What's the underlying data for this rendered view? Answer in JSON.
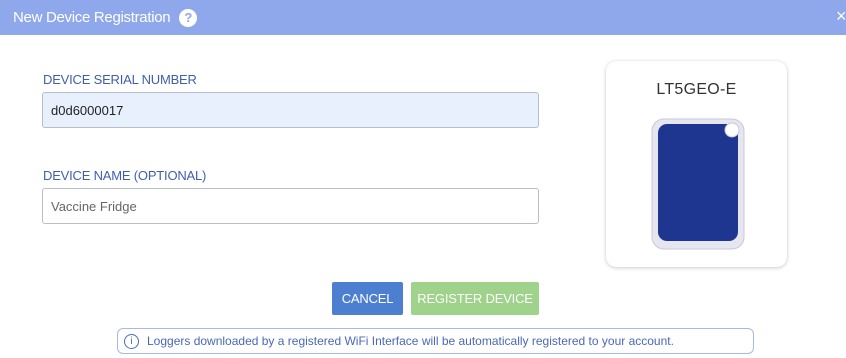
{
  "dialog": {
    "title": "New Device Registration",
    "help_icon": "?",
    "close_icon": "×"
  },
  "serial_field": {
    "label": "DEVICE SERIAL NUMBER",
    "value": "d0d6000017",
    "placeholder": ""
  },
  "name_field": {
    "label": "DEVICE NAME (OPTIONAL)",
    "value": "",
    "placeholder": "Vaccine Fridge"
  },
  "device_preview": {
    "model": "LT5GEO-E",
    "body_color": "#1f3690",
    "bezel_color": "#e6e6f0"
  },
  "buttons": {
    "cancel": "CANCEL",
    "register": "REGISTER DEVICE"
  },
  "info": {
    "icon": "i",
    "text": "Loggers downloaded by a registered WiFi Interface will be automatically registered to your account."
  },
  "colors": {
    "titlebar": "#8fa8ec",
    "primary": "#4d7fd1",
    "success": "#9fd28a",
    "label": "#3f5fae"
  }
}
